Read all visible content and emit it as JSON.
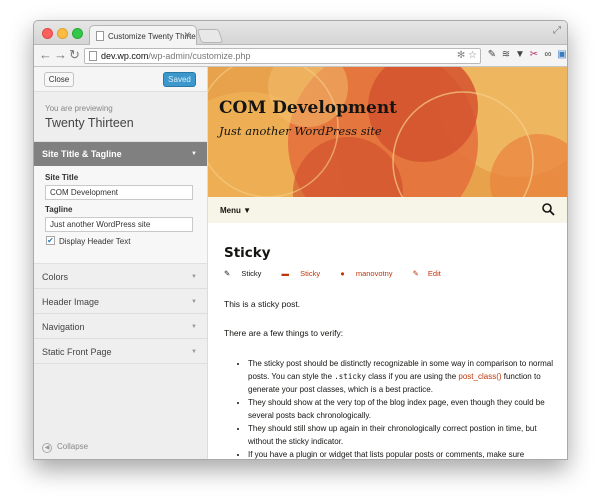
{
  "browser": {
    "tab_title": "Customize Twenty Thirtee",
    "url_host": "dev.wp.com",
    "url_path": "/wp-admin/customize.php"
  },
  "sidebar": {
    "close_label": "Close",
    "saved_label": "Saved",
    "previewing_label": "You are previewing",
    "theme_name": "Twenty Thirteen",
    "open_section": {
      "title": "Site Title & Tagline",
      "site_title_label": "Site Title",
      "site_title_value": "COM Development",
      "tagline_label": "Tagline",
      "tagline_value": "Just another WordPress site",
      "header_text_label": "Display Header Text",
      "header_text_checked": true
    },
    "sections": [
      "Colors",
      "Header Image",
      "Navigation",
      "Static Front Page"
    ],
    "collapse_label": "Collapse"
  },
  "preview": {
    "site_title": "COM Development",
    "site_description": "Just another WordPress site",
    "menu_label": "Menu",
    "post": {
      "title": "Sticky",
      "meta_sticky": "Sticky",
      "meta_category": "Sticky",
      "meta_author": "manovotny",
      "meta_edit": "Edit",
      "intro": "This is a sticky post.",
      "lead": "There are a few things to verify:",
      "item1_a": "The sticky post should be distinctly recognizable in some way in comparison to normal posts. You can style the ",
      "item1_code": ".sticky",
      "item1_b": " class if you are using the ",
      "item1_link": "post_class()",
      "item1_c": " function to generate your post classes, which is a best practice.",
      "item2": "They should show at the very top of the blog index page, even though they could be several posts back chronologically.",
      "item3": "They should still show up again in their chronologically correct postion in time, but without the sticky indicator.",
      "item4": "If you have a plugin or widget that lists popular posts or comments, make sure"
    }
  }
}
